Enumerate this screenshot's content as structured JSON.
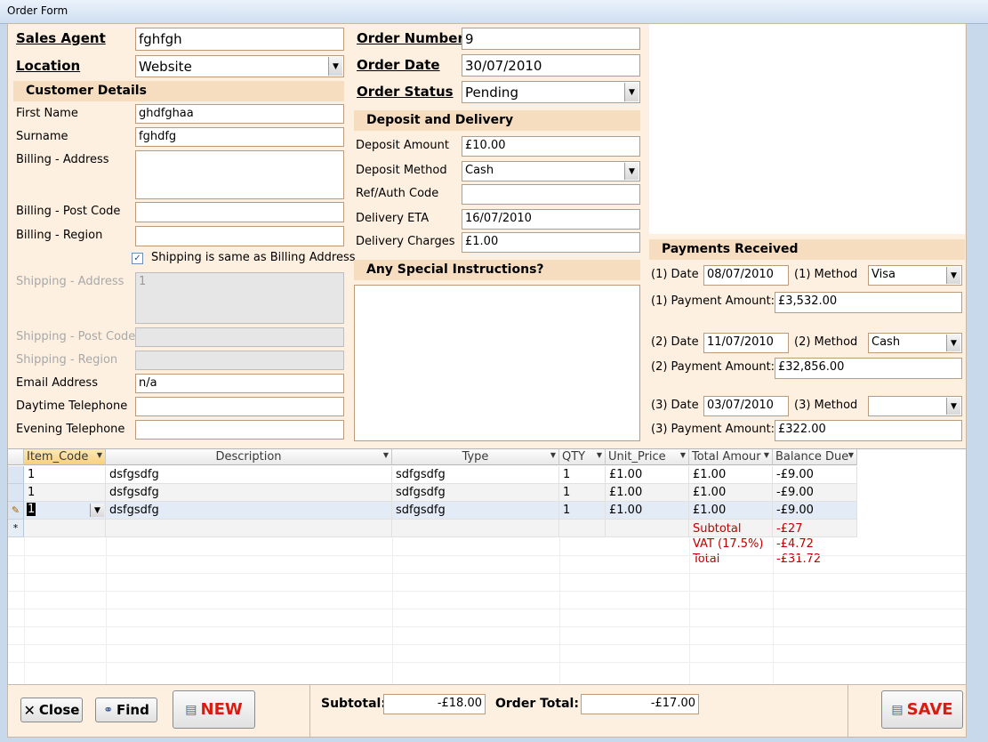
{
  "window": {
    "title": "Order Form"
  },
  "header": {
    "sales_agent_label": "Sales Agent",
    "sales_agent_value": "fghfgh",
    "location_label": "Location",
    "location_value": "Website",
    "order_number_label": "Order Number",
    "order_number_value": "9",
    "order_date_label": "Order Date",
    "order_date_value": "30/07/2010",
    "order_status_label": "Order Status",
    "order_status_value": "Pending"
  },
  "customer": {
    "section_title": "Customer Details",
    "first_name_label": "First Name",
    "first_name_value": "ghdfghaa",
    "surname_label": "Surname",
    "surname_value": "fghdfg",
    "billing_address_label": "Billing - Address",
    "billing_address_value": "",
    "billing_postcode_label": "Billing - Post Code",
    "billing_postcode_value": "",
    "billing_region_label": "Billing - Region",
    "billing_region_value": "",
    "shipping_same_label": "Shipping is same as Billing Address",
    "shipping_same_checked": true,
    "shipping_address_label": "Shipping - Address",
    "shipping_address_value": "1",
    "shipping_postcode_label": "Shipping - Post Code",
    "shipping_postcode_value": "",
    "shipping_region_label": "Shipping - Region",
    "shipping_region_value": "",
    "email_label": "Email Address",
    "email_value": "n/a",
    "daytime_label": "Daytime Telephone",
    "daytime_value": "",
    "evening_label": "Evening Telephone",
    "evening_value": ""
  },
  "deposit": {
    "section_title": "Deposit and Delivery",
    "amount_label": "Deposit Amount",
    "amount_value": "£10.00",
    "method_label": "Deposit Method",
    "method_value": "Cash",
    "ref_label": "Ref/Auth Code",
    "ref_value": "",
    "eta_label": "Delivery ETA",
    "eta_value": "16/07/2010",
    "charges_label": "Delivery Charges",
    "charges_value": "£1.00"
  },
  "instructions": {
    "section_title": "Any Special Instructions?",
    "value": ""
  },
  "payments": {
    "section_title": "Payments Received",
    "p1_date_label": "(1) Date",
    "p1_date_value": "08/07/2010",
    "p1_method_label": "(1) Method",
    "p1_method_value": "Visa",
    "p1_amount_label": "(1) Payment Amount:",
    "p1_amount_value": "£3,532.00",
    "p2_date_label": "(2) Date",
    "p2_date_value": "11/07/2010",
    "p2_method_label": "(2) Method",
    "p2_method_value": "Cash",
    "p2_amount_label": "(2) Payment Amount:",
    "p2_amount_value": "£32,856.00",
    "p3_date_label": "(3) Date",
    "p3_date_value": "03/07/2010",
    "p3_method_label": "(3) Method",
    "p3_method_value": "",
    "p3_amount_label": "(3) Payment Amount:",
    "p3_amount_value": "£322.00"
  },
  "grid": {
    "columns": [
      "Item_Code",
      "Description",
      "Type",
      "QTY",
      "Unit_Price",
      "Total Amour",
      "Balance Due"
    ],
    "rows": [
      [
        "1",
        "dsfgsdfg",
        "sdfgsdfg",
        "1",
        "£1.00",
        "£1.00",
        "-£9.00"
      ],
      [
        "1",
        "dsfgsdfg",
        "sdfgsdfg",
        "1",
        "£1.00",
        "£1.00",
        "-£9.00"
      ],
      [
        "1",
        "dsfgsdfg",
        "sdfgsdfg",
        "1",
        "£1.00",
        "£1.00",
        "-£9.00"
      ]
    ],
    "new_row_marker": "*",
    "edit_marker": "✎",
    "summary": {
      "subtotal_label": "Subtotal",
      "subtotal_value": "-£27",
      "vat_label": "VAT (17.5%)",
      "vat_value": "-£4.72",
      "total_label": "Total",
      "total_value": "-£31.72"
    }
  },
  "footer": {
    "close_label": "Close",
    "find_label": "Find",
    "new_label": "NEW",
    "save_label": "SAVE",
    "subtotal_label": "Subtotal:",
    "subtotal_value": "-£18.00",
    "order_total_label": "Order Total:",
    "order_total_value": "-£17.00"
  },
  "colors": {
    "form_bg": "#fdf0e0",
    "section_bg": "#f6ddc0",
    "accent_red": "#c00000"
  }
}
